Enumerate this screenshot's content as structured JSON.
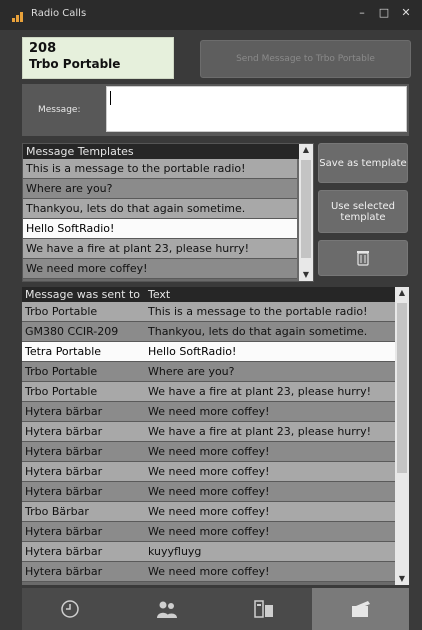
{
  "window": {
    "title": "Radio Calls",
    "min": "–",
    "max": "□",
    "close": "✕"
  },
  "contact": {
    "number": "208",
    "name": "Trbo Portable"
  },
  "send_button": "Send Message to Trbo Portable",
  "message": {
    "label": "Message:",
    "value": ""
  },
  "templates": {
    "header": "Message Templates",
    "rows": [
      "This is a message to the portable radio!",
      "Where are you?",
      "Thankyou, lets do that again sometime.",
      "Hello SoftRadio!",
      "We have a fire at plant 23, please hurry!",
      "We need more coffey!"
    ],
    "selected_index": 3
  },
  "side_buttons": {
    "save": "Save as template",
    "use": "Use selected template",
    "delete_icon": "trash-icon"
  },
  "log": {
    "col1": "Message was sent to",
    "col2": "Text",
    "rows": [
      [
        "Trbo Portable",
        "This is a message to the portable radio!"
      ],
      [
        "GM380 CCIR-209",
        "Thankyou, lets do that again sometime."
      ],
      [
        "Tetra Portable",
        "Hello SoftRadio!"
      ],
      [
        "Trbo Portable",
        "Where are you?"
      ],
      [
        "Trbo Portable",
        "We have a fire at plant 23, please hurry!"
      ],
      [
        "Hytera bärbar",
        "We need more coffey!"
      ],
      [
        "Hytera bärbar",
        "We have a fire at plant 23, please hurry!"
      ],
      [
        "Hytera bärbar",
        "We need more coffey!"
      ],
      [
        "Hytera bärbar",
        "We need more coffey!"
      ],
      [
        "Hytera bärbar",
        "We need more coffey!"
      ],
      [
        "Trbo Bärbar",
        "We need more coffey!"
      ],
      [
        "Hytera bärbar",
        "We need more coffey!"
      ],
      [
        "Hytera bärbar",
        "kuyyfluyg"
      ],
      [
        "Hytera bärbar",
        "We need more coffey!"
      ]
    ],
    "selected_index": 2
  },
  "tabs": [
    "clock-icon",
    "contacts-icon",
    "sms-icon",
    "messages-icon"
  ],
  "active_tab": 3
}
